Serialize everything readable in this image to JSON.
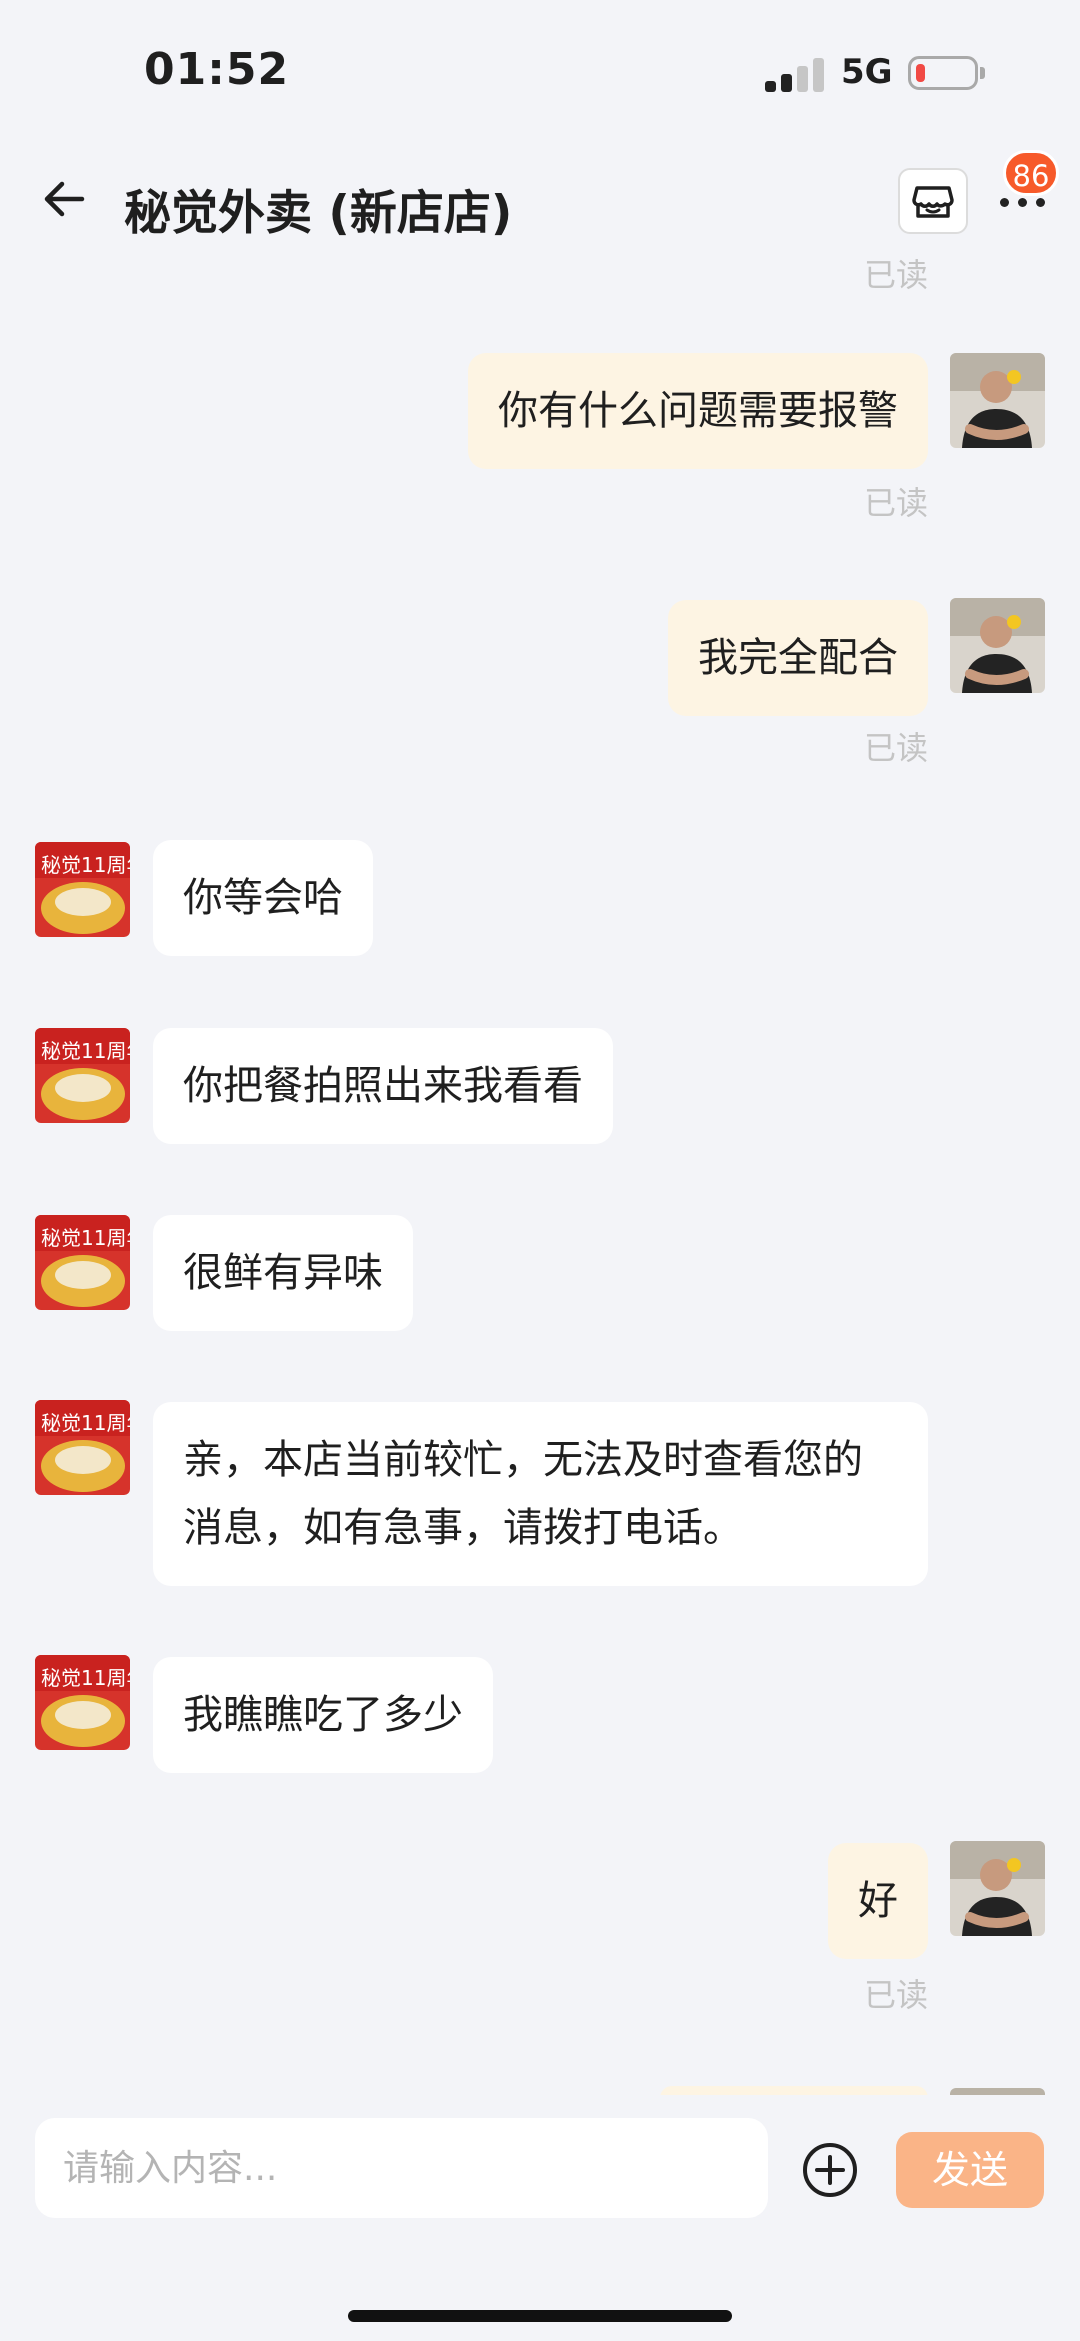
{
  "status_bar": {
    "time": "01:52",
    "network": "5G"
  },
  "header": {
    "title": "秘觉外卖 (新店店)",
    "badge_count": "86"
  },
  "chat": {
    "top_read": "已读",
    "messages": [
      {
        "from": "me",
        "text": "你有什么问题需要报警",
        "status": "已读"
      },
      {
        "from": "me",
        "text": "我完全配合",
        "status": "已读"
      },
      {
        "from": "shop",
        "text": "你等会哈"
      },
      {
        "from": "shop",
        "text": "你把餐拍照出来我看看"
      },
      {
        "from": "shop",
        "text": "很鲜有异味"
      },
      {
        "from": "shop",
        "text": "亲，本店当前较忙，无法及时查看您的消息，如有急事，请拨打电话。"
      },
      {
        "from": "shop",
        "text": "我瞧瞧吃了多少"
      },
      {
        "from": "me",
        "text": "好",
        "status": "已读"
      }
    ]
  },
  "input": {
    "placeholder": "请输入内容...",
    "send_label": "发送"
  },
  "colors": {
    "accent": "#fab487",
    "badge": "#f75a2a",
    "my_bubble": "#fdf4e3",
    "shop_bubble": "#ffffff"
  },
  "icons": [
    "back-arrow-icon",
    "store-icon",
    "more-icon",
    "plus-icon",
    "signal-icon",
    "battery-icon"
  ]
}
